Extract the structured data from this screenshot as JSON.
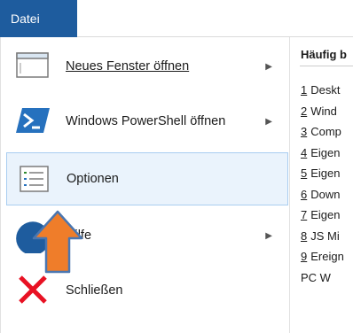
{
  "ribbon": {
    "file_tab": "Datei"
  },
  "menu": {
    "items": [
      {
        "label": "Neues Fenster öffnen",
        "has_submenu": true,
        "icon": "window-icon"
      },
      {
        "label": "Windows PowerShell öffnen",
        "has_submenu": true,
        "icon": "powershell-icon"
      },
      {
        "label": "Optionen",
        "has_submenu": false,
        "icon": "options-icon",
        "selected": true
      },
      {
        "label": "Hilfe",
        "has_submenu": true,
        "icon": "help-icon"
      },
      {
        "label": "Schließen",
        "has_submenu": false,
        "icon": "close-icon"
      }
    ],
    "submenu_glyph": "▶"
  },
  "recent": {
    "title": "Häufig b",
    "items": [
      {
        "num": "1",
        "text": "Deskt"
      },
      {
        "num": "2",
        "text": "Wind"
      },
      {
        "num": "3",
        "text": "Comp"
      },
      {
        "num": "4",
        "text": "Eigen"
      },
      {
        "num": "5",
        "text": "Eigen"
      },
      {
        "num": "6",
        "text": "Down"
      },
      {
        "num": "7",
        "text": "Eigen"
      },
      {
        "num": "8",
        "text": "JS Mi"
      },
      {
        "num": "9",
        "text": "Ereign"
      },
      {
        "num": "",
        "text": "PC W"
      }
    ]
  },
  "colors": {
    "file_tab": "#1e5c9e",
    "selected_bg": "#eaf3fc",
    "selected_border": "#a9cdf0",
    "powershell": "#2671be",
    "close_red": "#e81123",
    "cursor_orange": "#ef7d2a",
    "cursor_outline": "#4a76b0"
  }
}
